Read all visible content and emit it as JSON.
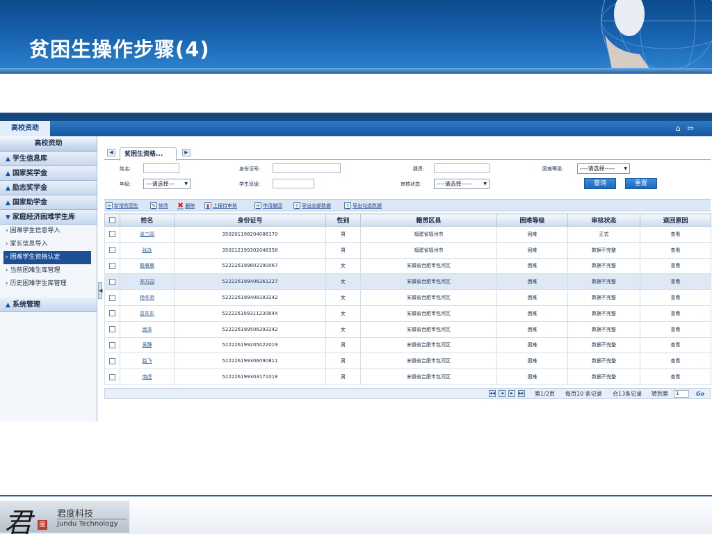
{
  "slide": {
    "title": "贫困生操作步骤(4)"
  },
  "app": {
    "top_tab": "高校资助",
    "icons": [
      "home-icon",
      "logout-icon"
    ]
  },
  "sidebar": {
    "header": "高校资助",
    "sections_top": [
      "学生信息库",
      "国家奖学金",
      "励志奖学金",
      "国家助学金"
    ],
    "expanded_section": "家庭经济困难学生库",
    "sub_items": [
      "困难学生信息导入",
      "家长信息导入",
      "困难学生资格认定",
      "当前困难生库管理",
      "历史困难学生库管理"
    ],
    "active_sub_index": 2,
    "bottom_section": "系统管理"
  },
  "tabs": {
    "active_label": "贫困生资格..."
  },
  "search": {
    "name_label": "姓名:",
    "id_label": "身份证号:",
    "origin_label": "籍贯:",
    "level_label": "困难等级:",
    "level_value": "----请选择-----",
    "grade_label": "年级:",
    "grade_value": "---请选择---",
    "class_label": "学生班级:",
    "status_label": "审核状态:",
    "status_value": "----请选择-----",
    "query_button": "查询",
    "reset_button": "重置"
  },
  "toolbar": {
    "add": "新增贫困生",
    "edit": "修改",
    "delete": "删除",
    "upload": "上报待审核",
    "apply": "申请撤回",
    "export_all": "导出全部数据",
    "export_selected": "导出勾选数据"
  },
  "table": {
    "headers": [
      "姓名",
      "身份证号",
      "性别",
      "籍贯区县",
      "困难等级",
      "审核状态",
      "退回原因"
    ],
    "rows": [
      [
        "张三四",
        "350201198204086170",
        "男",
        "福建省福州市",
        "困难",
        "正式",
        "查看"
      ],
      [
        "张办",
        "350212199302048358",
        "男",
        "福建省福州市",
        "困难",
        "数据不完整",
        "查看"
      ],
      [
        "殷晨晨",
        "522226199602190067",
        "女",
        "安徽省合肥市包河区",
        "困难",
        "数据不完整",
        "查看"
      ],
      [
        "郑方园",
        "522226199406261227",
        "女",
        "安徽省合肥市包河区",
        "困难",
        "数据不完整",
        "查看"
      ],
      [
        "杨冬驹",
        "522226199408183242",
        "女",
        "安徽省合肥市包河区",
        "困难",
        "数据不完整",
        "查看"
      ],
      [
        "袁东东",
        "52222619931123084X",
        "女",
        "安徽省合肥市包河区",
        "困难",
        "数据不完整",
        "查看"
      ],
      [
        "武泽",
        "522226199506293242",
        "女",
        "安徽省合肥市包河区",
        "困难",
        "数据不完整",
        "查看"
      ],
      [
        "吴静",
        "522226199205022019",
        "男",
        "安徽省合肥市包河区",
        "困难",
        "数据不完整",
        "查看"
      ],
      [
        "路飞",
        "522226199306090811",
        "男",
        "安徽省合肥市包河区",
        "困难",
        "数据不完整",
        "查看"
      ],
      [
        "南虎",
        "522226199303171018",
        "男",
        "安徽省合肥市包河区",
        "困难",
        "数据不完整",
        "查看"
      ]
    ],
    "highlighted_row_index": 3
  },
  "pager": {
    "page_info": "第1/2页",
    "per_page": "每页10 条记录",
    "total": "合13条记录",
    "goto_label": "转到第",
    "goto_value": "1",
    "go": "Go"
  },
  "footer": {
    "logo_char": "君",
    "seal_char": "度",
    "company_cn": "君度科技",
    "company_en": "Jundu Technology"
  }
}
